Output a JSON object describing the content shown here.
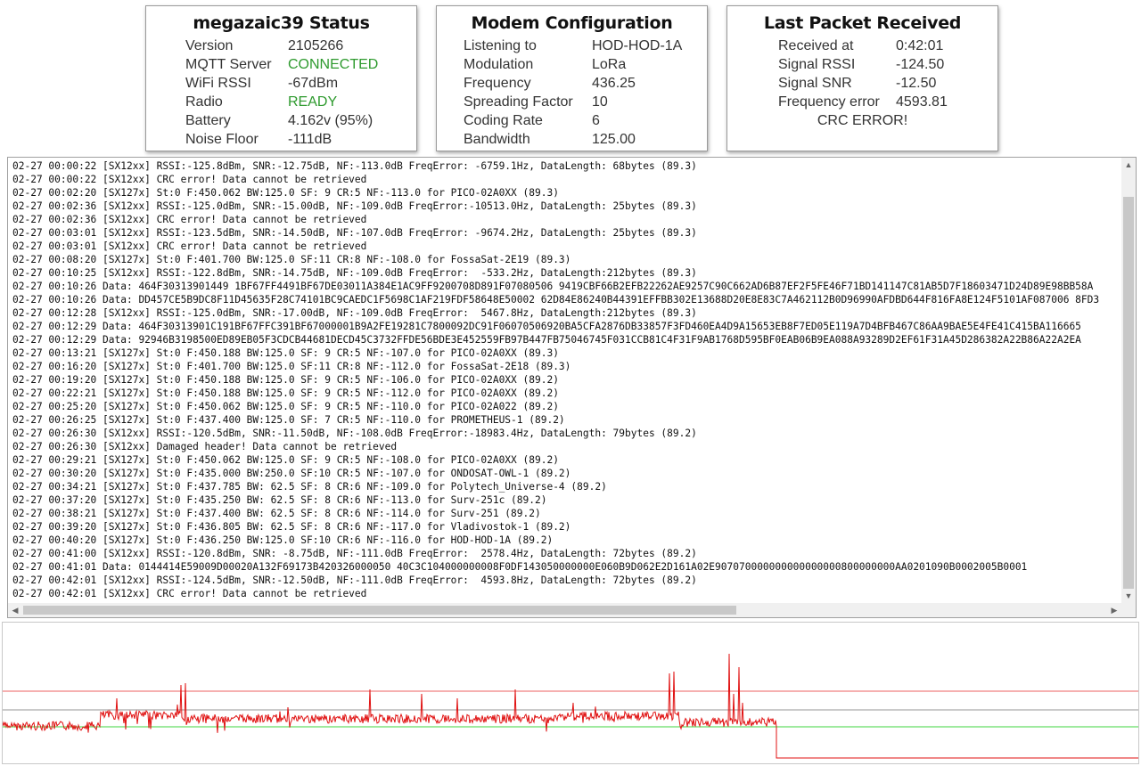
{
  "status": {
    "title": "megazaic39 Status",
    "rows": [
      {
        "k": "Version",
        "v": "2105266",
        "green": false
      },
      {
        "k": "MQTT Server",
        "v": "CONNECTED",
        "green": true
      },
      {
        "k": "WiFi RSSI",
        "v": "-67dBm",
        "green": false
      },
      {
        "k": "Radio",
        "v": "READY",
        "green": true
      },
      {
        "k": "Battery",
        "v": "4.162v (95%)",
        "green": false
      },
      {
        "k": "Noise Floor",
        "v": "-111dB",
        "green": false
      }
    ]
  },
  "modem": {
    "title": "Modem Configuration",
    "rows": [
      {
        "k": "Listening to",
        "v": "HOD-HOD-1A"
      },
      {
        "k": "Modulation",
        "v": "LoRa"
      },
      {
        "k": "Frequency",
        "v": "436.25"
      },
      {
        "k": "Spreading Factor",
        "v": "10"
      },
      {
        "k": "Coding Rate",
        "v": "6"
      },
      {
        "k": "Bandwidth",
        "v": "125.00"
      }
    ]
  },
  "packet": {
    "title": "Last Packet Received",
    "rows": [
      {
        "k": "Received at",
        "v": "0:42:01"
      },
      {
        "k": "Signal RSSI",
        "v": "-124.50"
      },
      {
        "k": "Signal SNR",
        "v": "-12.50"
      },
      {
        "k": "Frequency error",
        "v": "4593.81"
      }
    ],
    "note": "CRC ERROR!"
  },
  "log": [
    "02-27 00:00:22 [SX12xx] RSSI:-125.8dBm, SNR:-12.75dB, NF:-113.0dB FreqError: -6759.1Hz, DataLength: 68bytes (89.3)",
    "02-27 00:00:22 [SX12xx] CRC error! Data cannot be retrieved",
    "02-27 00:02:20 [SX127x] St:0 F:450.062 BW:125.0 SF: 9 CR:5 NF:-113.0 for PICO-02A0XX (89.3)",
    "02-27 00:02:36 [SX12xx] RSSI:-125.0dBm, SNR:-15.00dB, NF:-109.0dB FreqError:-10513.0Hz, DataLength: 25bytes (89.3)",
    "02-27 00:02:36 [SX12xx] CRC error! Data cannot be retrieved",
    "02-27 00:03:01 [SX12xx] RSSI:-123.5dBm, SNR:-14.50dB, NF:-107.0dB FreqError: -9674.2Hz, DataLength: 25bytes (89.3)",
    "02-27 00:03:01 [SX12xx] CRC error! Data cannot be retrieved",
    "02-27 00:08:20 [SX127x] St:0 F:401.700 BW:125.0 SF:11 CR:8 NF:-108.0 for FossaSat-2E19 (89.3)",
    "02-27 00:10:25 [SX12xx] RSSI:-122.8dBm, SNR:-14.75dB, NF:-109.0dB FreqError:  -533.2Hz, DataLength:212bytes (89.3)",
    "02-27 00:10:26 Data: 464F30313901449 1BF67FF4491BF67DE03011A384E1AC9FF9200708D891F07080506 9419CBF66B2EFB22262AE9257C90C662AD6B87EF2F5FE46F71BD141147C81AB5D7F18603471D24D89E98BB58A",
    "02-27 00:10:26 Data: DD457CE5B9DC8F11D45635F28C74101BC9CAEDC1F5698C1AF219FDF58648E50002 62D84E86240B44391EFFBB302E13688D20E8E83C7A462112B0D96990AFDBD644F816FA8E124F5101AF087006 8FD3",
    "02-27 00:12:28 [SX12xx] RSSI:-125.0dBm, SNR:-17.00dB, NF:-109.0dB FreqError:  5467.8Hz, DataLength:212bytes (89.3)",
    "02-27 00:12:29 Data: 464F30313901C191BF67FFC391BF67000001B9A2FE19281C7800092DC91F06070506920BA5CFA2876DB33857F3FD460EA4D9A15653EB8F7ED05E119A7D4BFB467C86AA9BAE5E4FE41C415BA116665",
    "02-27 00:12:29 Data: 92946B3198500ED89EB05F3CDCB44681DECD45C3732FFDE56BDE3E452559FB97B447FB75046745F031CCB81C4F31F9AB1768D595BF0EAB06B9EA088A93289D2EF61F31A45D286382A22B86A22A2EA",
    "02-27 00:13:21 [SX127x] St:0 F:450.188 BW:125.0 SF: 9 CR:5 NF:-107.0 for PICO-02A0XX (89.3)",
    "02-27 00:16:20 [SX127x] St:0 F:401.700 BW:125.0 SF:11 CR:8 NF:-112.0 for FossaSat-2E18 (89.3)",
    "02-27 00:19:20 [SX127x] St:0 F:450.188 BW:125.0 SF: 9 CR:5 NF:-106.0 for PICO-02A0XX (89.2)",
    "02-27 00:22:21 [SX127x] St:0 F:450.188 BW:125.0 SF: 9 CR:5 NF:-112.0 for PICO-02A0XX (89.2)",
    "02-27 00:25:20 [SX127x] St:0 F:450.062 BW:125.0 SF: 9 CR:5 NF:-110.0 for PICO-02A022 (89.2)",
    "02-27 00:26:25 [SX127x] St:0 F:437.400 BW:125.0 SF: 7 CR:5 NF:-110.0 for PROMETHEUS-1 (89.2)",
    "02-27 00:26:30 [SX12xx] RSSI:-120.5dBm, SNR:-11.50dB, NF:-108.0dB FreqError:-18983.4Hz, DataLength: 79bytes (89.2)",
    "02-27 00:26:30 [SX12xx] Damaged header! Data cannot be retrieved",
    "02-27 00:29:21 [SX127x] St:0 F:450.062 BW:125.0 SF: 9 CR:5 NF:-108.0 for PICO-02A0XX (89.2)",
    "02-27 00:30:20 [SX127x] St:0 F:435.000 BW:250.0 SF:10 CR:5 NF:-107.0 for ONDOSAT-OWL-1 (89.2)",
    "02-27 00:34:21 [SX127x] St:0 F:437.785 BW: 62.5 SF: 8 CR:6 NF:-109.0 for Polytech_Universe-4 (89.2)",
    "02-27 00:37:20 [SX127x] St:0 F:435.250 BW: 62.5 SF: 8 CR:6 NF:-113.0 for Surv-251c (89.2)",
    "02-27 00:38:21 [SX127x] St:0 F:437.400 BW: 62.5 SF: 8 CR:6 NF:-114.0 for Surv-251 (89.2)",
    "02-27 00:39:20 [SX127x] St:0 F:436.805 BW: 62.5 SF: 8 CR:6 NF:-117.0 for Vladivostok-1 (89.2)",
    "02-27 00:40:20 [SX127x] St:0 F:436.250 BW:125.0 SF:10 CR:6 NF:-116.0 for HOD-HOD-1A (89.2)",
    "02-27 00:41:00 [SX12xx] RSSI:-120.8dBm, SNR: -8.75dB, NF:-111.0dB FreqError:  2578.4Hz, DataLength: 72bytes (89.2)",
    "02-27 00:41:01 Data: 0144414E59009D00020A132F69173B420326000050 40C3C104000000008F0DF143050000000E060B9D062E2D161A02E907070000000000000000800000000AA0201090B0002005B0001",
    "02-27 00:42:01 [SX12xx] RSSI:-124.5dBm, SNR:-12.50dB, NF:-111.0dB FreqError:  4593.8Hz, DataLength: 72bytes (89.2)",
    "02-27 00:42:01 [SX12xx] CRC error! Data cannot be retrieved"
  ],
  "scroll_arrows": {
    "up": "▲",
    "down": "▼",
    "left": "◀",
    "right": "▶"
  },
  "graph": {
    "colors": {
      "signal": "#e01010",
      "upper": "#f08080",
      "middle": "#b8b8b8",
      "lower": "#66dd66"
    }
  }
}
